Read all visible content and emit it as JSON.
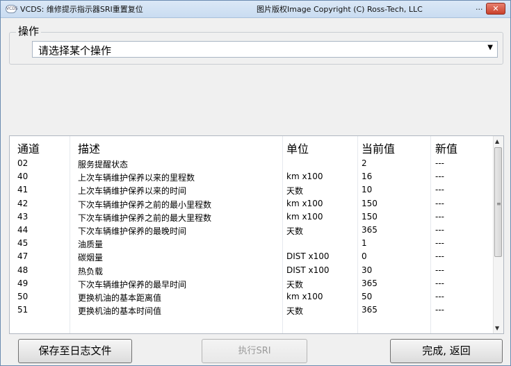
{
  "window": {
    "icon_label": "VCDS",
    "title": "VCDS:  维修提示指示器SRI重置复位",
    "copyright": "图片版权Image Copyright (C) Ross-Tech, LLC",
    "dots": "...",
    "close_glyph": "✕"
  },
  "operation": {
    "group_label": "操作",
    "selected": "请选择某个操作"
  },
  "table": {
    "headers": {
      "channel": "通道",
      "description": "描述",
      "unit": "单位",
      "current": "当前值",
      "new": "新值"
    },
    "rows": [
      {
        "channel": "02",
        "description": "服务提醒状态",
        "unit": "",
        "current": "2",
        "new": "---"
      },
      {
        "channel": "40",
        "description": "上次车辆维护保养以来的里程数",
        "unit": "km x100",
        "current": "16",
        "new": "---"
      },
      {
        "channel": "41",
        "description": "上次车辆维护保养以来的时间",
        "unit": "天数",
        "current": "10",
        "new": "---"
      },
      {
        "channel": "42",
        "description": "下次车辆维护保养之前的最小里程数",
        "unit": "km x100",
        "current": "150",
        "new": "---"
      },
      {
        "channel": "43",
        "description": "下次车辆维护保养之前的最大里程数",
        "unit": "km x100",
        "current": "150",
        "new": "---"
      },
      {
        "channel": "44",
        "description": "下次车辆维护保养的最晚时间",
        "unit": "天数",
        "current": "365",
        "new": "---"
      },
      {
        "channel": "45",
        "description": "油质量",
        "unit": "",
        "current": "1",
        "new": "---"
      },
      {
        "channel": "47",
        "description": "碳烟量",
        "unit": "DIST x100",
        "current": "0",
        "new": "---"
      },
      {
        "channel": "48",
        "description": "热负载",
        "unit": "DIST x100",
        "current": "30",
        "new": "---"
      },
      {
        "channel": "49",
        "description": "下次车辆维护保养的最早时间",
        "unit": "天数",
        "current": "365",
        "new": "---"
      },
      {
        "channel": "50",
        "description": "更换机油的基本距离值",
        "unit": "km x100",
        "current": "50",
        "new": "---"
      },
      {
        "channel": "51",
        "description": "更换机油的基本时间值",
        "unit": "天数",
        "current": "365",
        "new": "---"
      }
    ]
  },
  "buttons": {
    "save_log": "保存至日志文件",
    "execute_sri": "执行SRI",
    "done_back": "完成, 返回"
  }
}
